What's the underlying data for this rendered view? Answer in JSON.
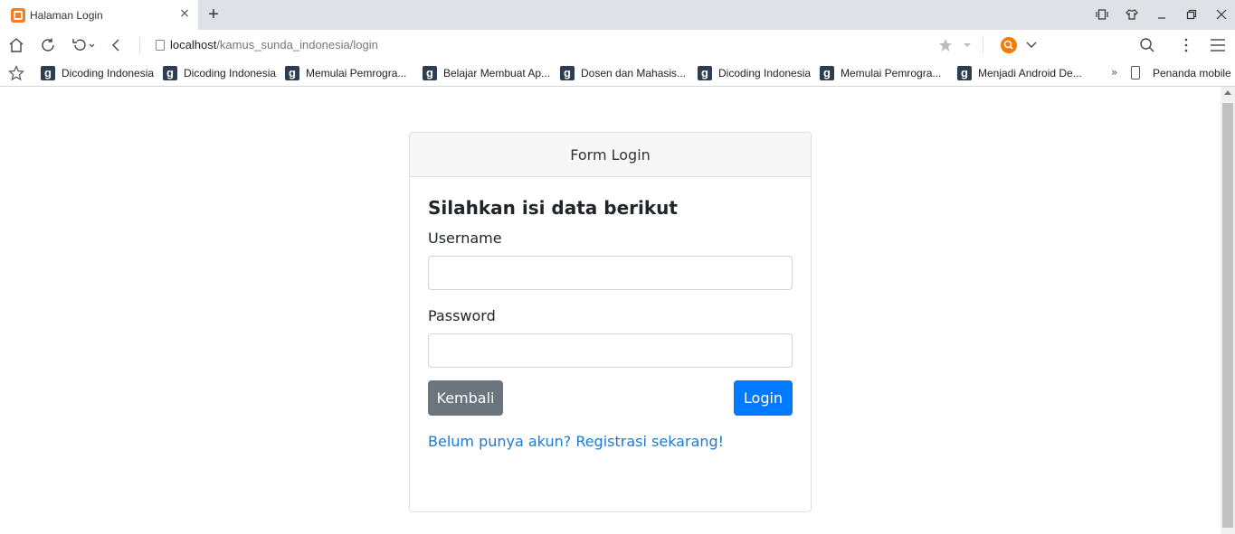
{
  "browser": {
    "tab": {
      "title": "Halaman Login"
    },
    "url": {
      "host": "localhost",
      "path": "/kamus_sunda_indonesia/login"
    },
    "bookmarks": [
      {
        "label": "Dicoding Indonesia"
      },
      {
        "label": "Dicoding Indonesia"
      },
      {
        "label": "Memulai Pemrogra..."
      },
      {
        "label": "Belajar Membuat Ap..."
      },
      {
        "label": "Dosen dan Mahasis..."
      },
      {
        "label": "Dicoding Indonesia"
      },
      {
        "label": "Memulai Pemrogra..."
      },
      {
        "label": "Menjadi Android De..."
      }
    ],
    "bookmarks_more": "»",
    "mobile_bookmarks": "Penanda mobile",
    "bookmark_icon_glyph": "g"
  },
  "login": {
    "header": "Form Login",
    "heading": "Silahkan isi data berikut",
    "username_label": "Username",
    "username_value": "",
    "password_label": "Password",
    "password_value": "",
    "back_button": "Kembali",
    "login_button": "Login",
    "register_link": "Belum punya akun? Registrasi sekarang!"
  },
  "colors": {
    "primary": "#007bff",
    "secondary": "#6c757d",
    "link": "#1a7bd6",
    "favicon": "#fb7a24"
  }
}
